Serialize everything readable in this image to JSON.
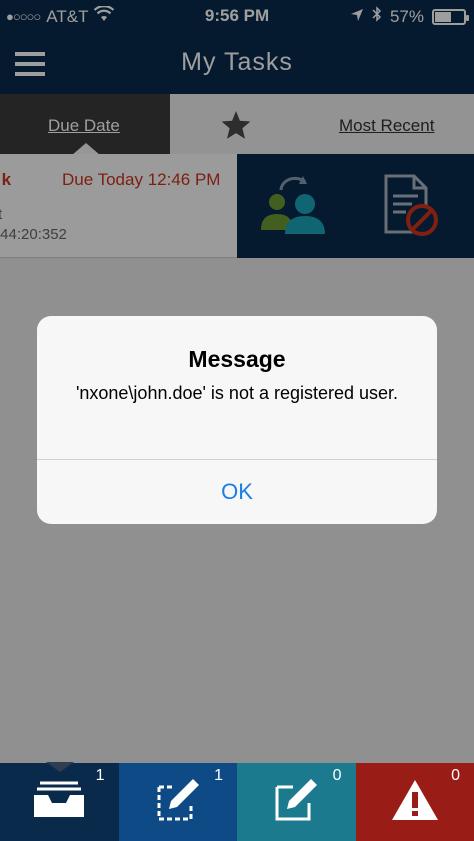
{
  "status_bar": {
    "signal": "●○○○○",
    "carrier": "AT&T",
    "time": "9:56 PM",
    "battery_percent": "57%",
    "battery_level": 0.57
  },
  "nav": {
    "title": "My Tasks"
  },
  "sort_tabs": {
    "due_date": "Due Date",
    "most_recent": "Most Recent",
    "favorites_icon": "star-icon"
  },
  "task": {
    "title_partial": "·k",
    "due": "Due Today 12:46 PM",
    "sub1_partial": "t",
    "sub2_partial": ":44:20:352",
    "actions": [
      "reassign-users-icon",
      "reject-document-icon"
    ]
  },
  "alert": {
    "title": "Message",
    "message": "'nxone\\john.doe' is not a registered user.",
    "ok_label": "OK"
  },
  "bottom_tabs": [
    {
      "name": "inbox",
      "icon": "inbox-tray-icon",
      "count": "1",
      "color": "#0a2a4c"
    },
    {
      "name": "draft",
      "icon": "pencil-frame-icon",
      "count": "1",
      "color": "#0e4a86"
    },
    {
      "name": "edit",
      "icon": "edit-square-icon",
      "count": "0",
      "color": "#1c7a8e"
    },
    {
      "name": "alerts",
      "icon": "warning-icon",
      "count": "0",
      "color": "#9a1c16"
    }
  ],
  "colors": {
    "primary_navy": "#0a2a4c",
    "alert_red": "#c8351f",
    "ios_blue": "#1a7ee8"
  }
}
